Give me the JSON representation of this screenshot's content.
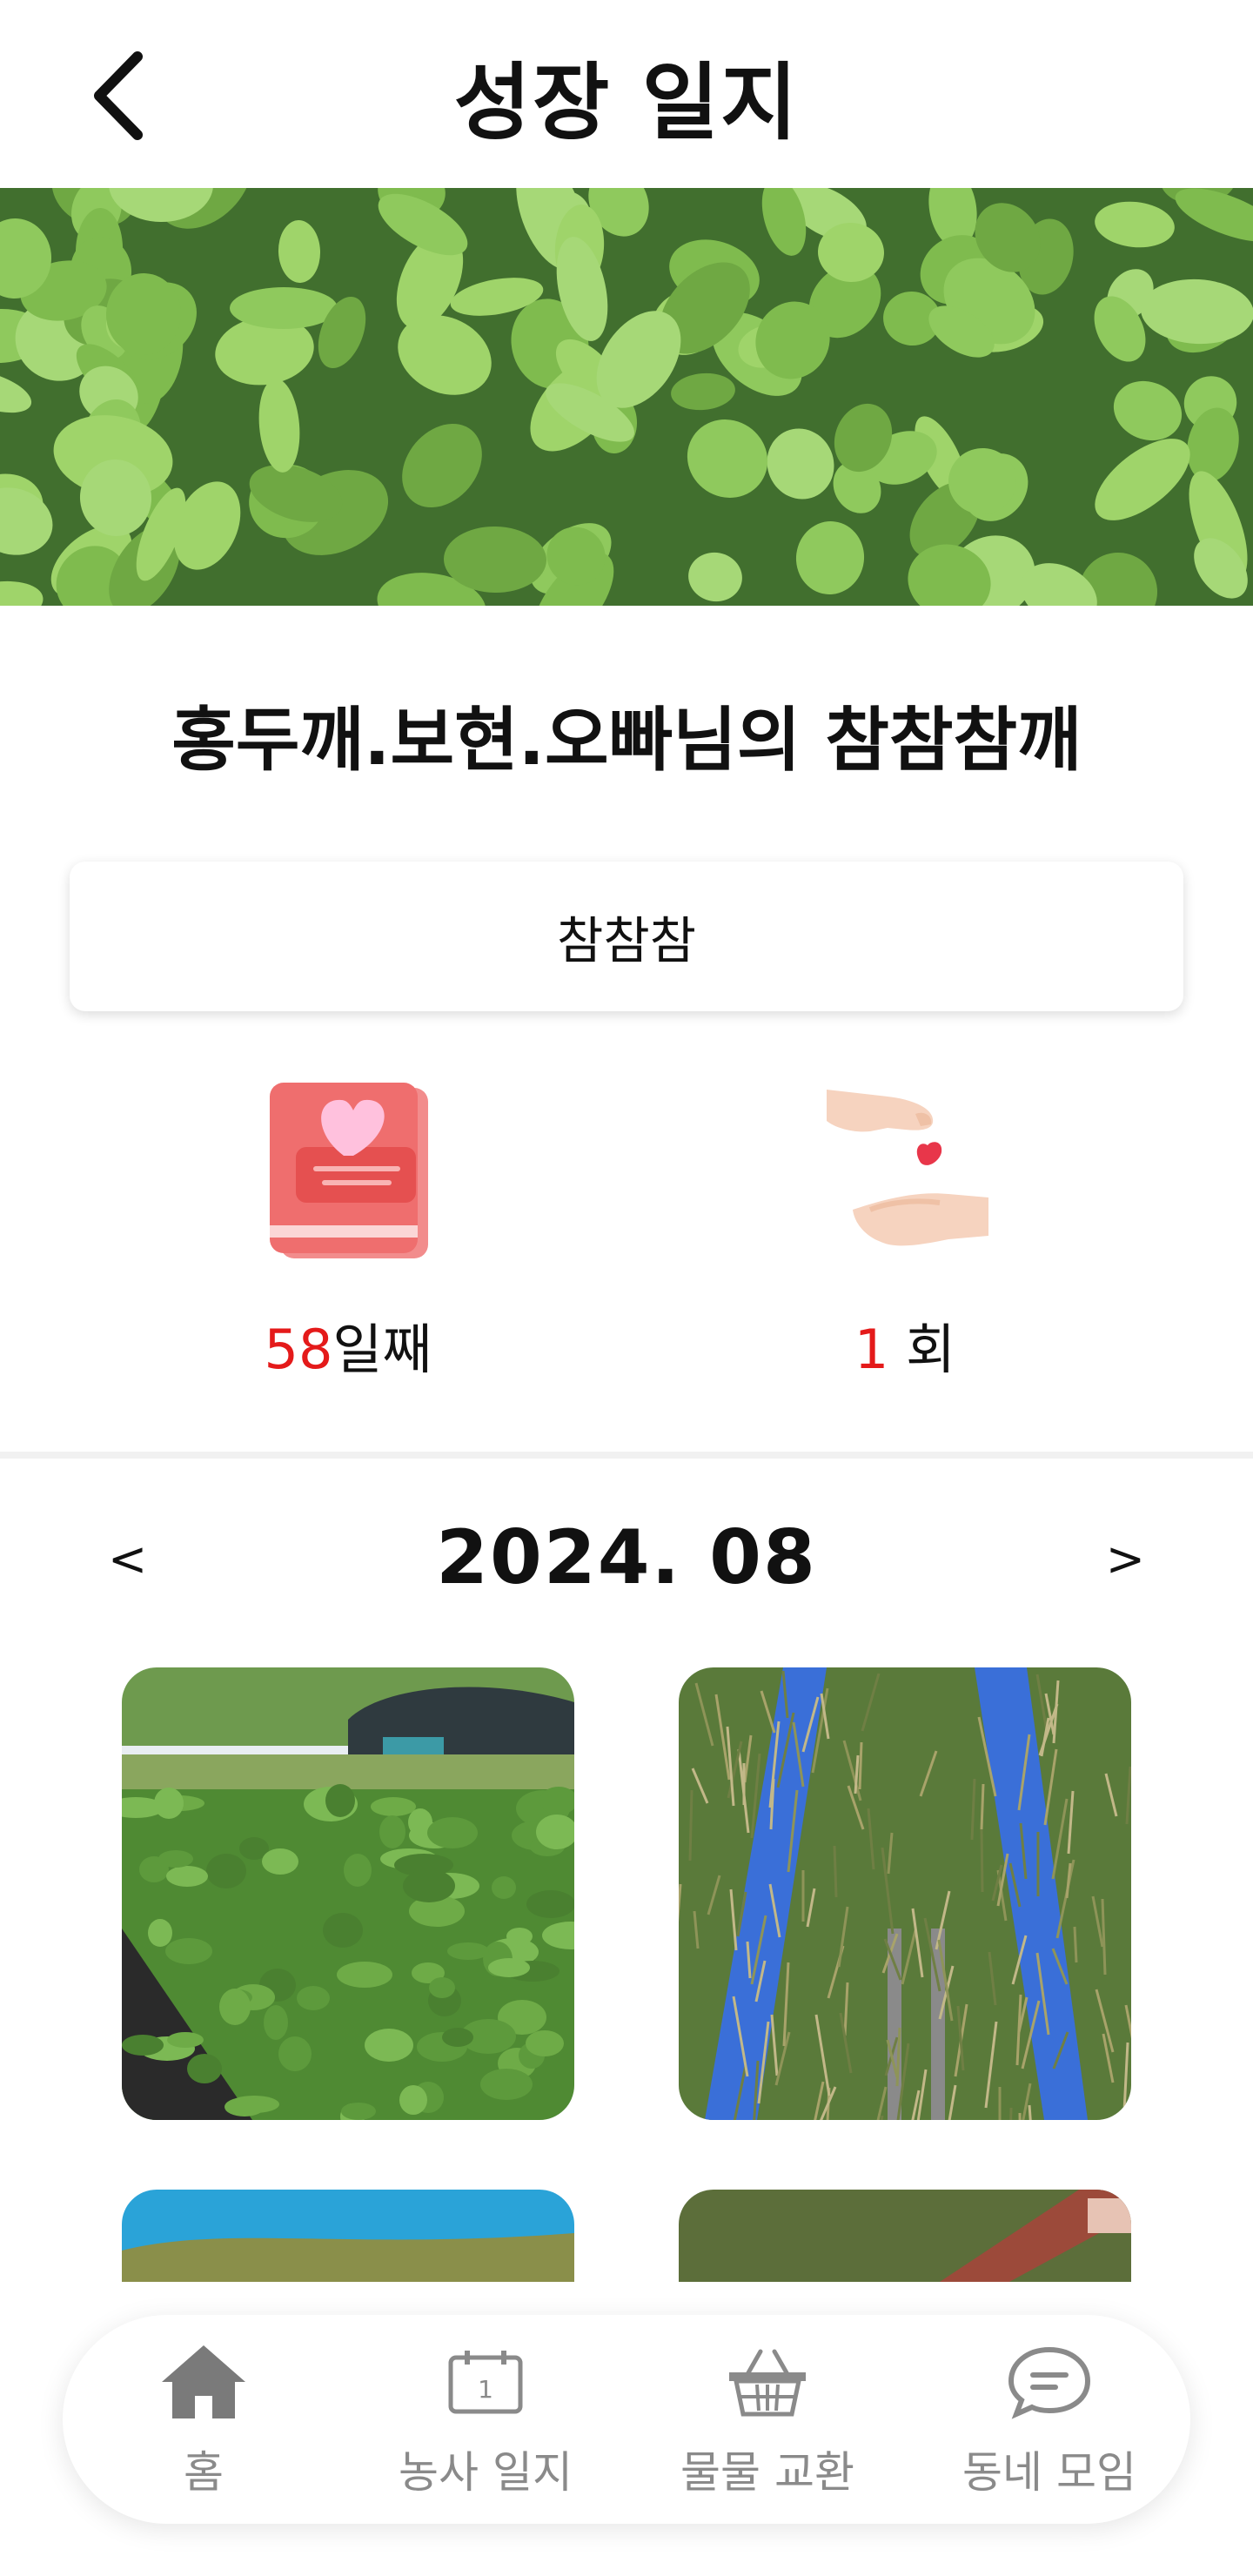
{
  "header": {
    "title": "성장 일지"
  },
  "plant": {
    "name": "홍두깨.보현.오빠님의 참참참깨",
    "memo": "참참참"
  },
  "stats": {
    "days": {
      "number": "58",
      "suffix": "일째"
    },
    "shares": {
      "number": "1",
      "suffix": " 회"
    }
  },
  "calendar": {
    "prev": "<",
    "month": "2024. 08",
    "next": ">"
  },
  "bottom_nav": [
    {
      "label": "홈",
      "icon": "home-icon"
    },
    {
      "label": "농사 일지",
      "icon": "calendar-icon"
    },
    {
      "label": "물물 교환",
      "icon": "basket-icon"
    },
    {
      "label": "동네 모임",
      "icon": "chat-icon"
    }
  ],
  "colors": {
    "accent_red": "#e41a1a",
    "nav_gray": "#8a8a8a",
    "divider": "#f1f1f1"
  }
}
